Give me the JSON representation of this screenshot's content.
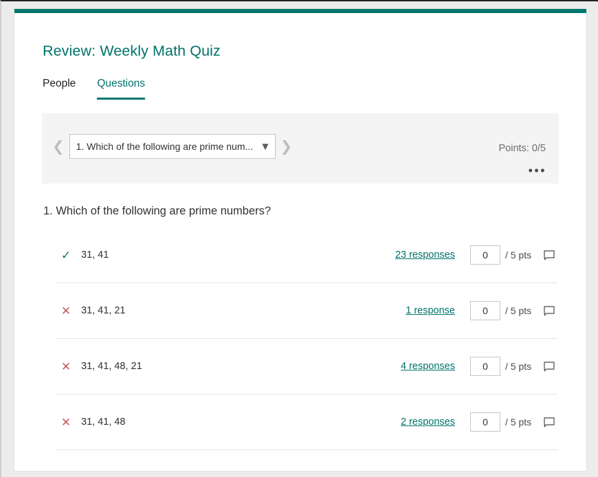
{
  "window": {
    "accent_color": "#00776d",
    "background": "#ffffff"
  },
  "header": {
    "title": "Review: Weekly Math Quiz"
  },
  "tabs": [
    {
      "label": "People",
      "active": false
    },
    {
      "label": "Questions",
      "active": true
    }
  ],
  "question_nav": {
    "prev_icon": "chevron-left-icon",
    "next_icon": "chevron-right-icon",
    "selected_question": "1. Which of the following are prime num...",
    "dropdown_icon": "chevron-down-icon",
    "points_label": "Points: 0/5",
    "more_options": "• • •"
  },
  "question": {
    "heading": "1. Which of the following are prime numbers?",
    "max_points": "5",
    "answers": [
      {
        "mark": "correct",
        "mark_glyph": "✓",
        "text": "31, 41",
        "responses_label": "23 responses",
        "response_count": 23,
        "score_value": "0",
        "points_label": "/ 5 pts",
        "comment_icon": "comment-icon"
      },
      {
        "mark": "wrong",
        "mark_glyph": "✕",
        "text": "31, 41, 21",
        "responses_label": "1 response",
        "response_count": 1,
        "score_value": "0",
        "points_label": "/ 5 pts",
        "comment_icon": "comment-icon"
      },
      {
        "mark": "wrong",
        "mark_glyph": "✕",
        "text": "31, 41, 48, 21",
        "responses_label": "4 responses",
        "response_count": 4,
        "score_value": "0",
        "points_label": "/ 5 pts",
        "comment_icon": "comment-icon"
      },
      {
        "mark": "wrong",
        "mark_glyph": "✕",
        "text": "31, 41, 48",
        "responses_label": "2 responses",
        "response_count": 2,
        "score_value": "0",
        "points_label": "/ 5 pts",
        "comment_icon": "comment-icon"
      }
    ]
  },
  "colors": {
    "accent": "#00776d",
    "link": "#00726a",
    "correct": "#107c41",
    "wrong": "#c55a5a",
    "panel_bg": "#f4f4f4"
  }
}
